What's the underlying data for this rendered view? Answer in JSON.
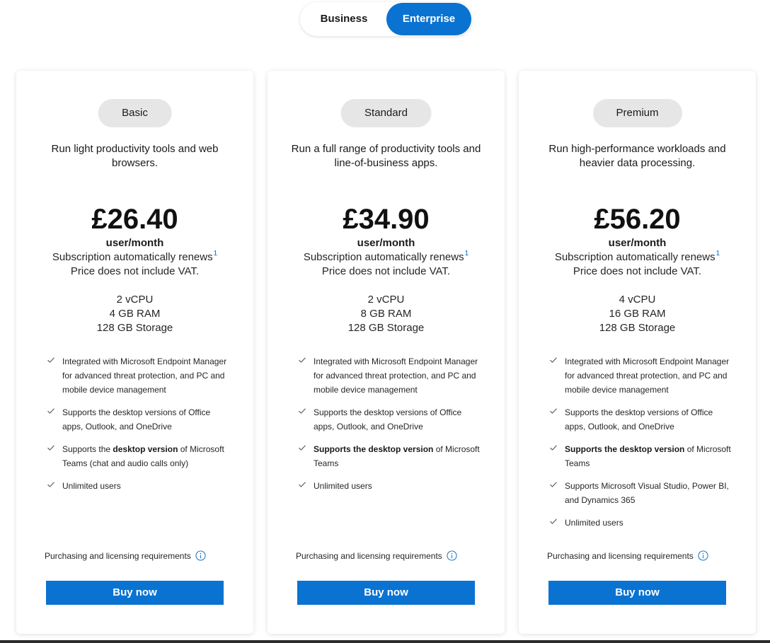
{
  "toggle": {
    "business_label": "Business",
    "enterprise_label": "Enterprise",
    "selected": "Enterprise"
  },
  "colors": {
    "accent": "#0a73d1",
    "pill_bg": "#e6e6e6",
    "footnote": "#0a6cbd"
  },
  "plans": [
    {
      "name": "Basic",
      "description": "Run light productivity tools and web browsers.",
      "price": "£26.40",
      "per": "user/month",
      "renews": "Subscription automatically renews",
      "renews_footnote": "1",
      "vat": "Price does not include VAT.",
      "specs": [
        "2 vCPU",
        "4 GB RAM",
        "128 GB Storage"
      ],
      "features": [
        {
          "pre": "Integrated with Microsoft Endpoint Manager for advanced threat protection, and PC and mobile device management",
          "bold": "",
          "post": ""
        },
        {
          "pre": "Supports the desktop versions of Office apps, Outlook, and OneDrive",
          "bold": "",
          "post": ""
        },
        {
          "pre": "Supports the ",
          "bold": "desktop version",
          "post": " of Microsoft Teams (chat and audio calls only)"
        },
        {
          "pre": "Unlimited users",
          "bold": "",
          "post": ""
        }
      ],
      "requirements": "Purchasing and licensing requirements",
      "buy_label": "Buy now"
    },
    {
      "name": "Standard",
      "description": "Run a full range of productivity tools and line-of-business apps.",
      "price": "£34.90",
      "per": "user/month",
      "renews": "Subscription automatically renews",
      "renews_footnote": "1",
      "vat": "Price does not include VAT.",
      "specs": [
        "2 vCPU",
        "8 GB RAM",
        "128 GB Storage"
      ],
      "features": [
        {
          "pre": "Integrated with Microsoft Endpoint Manager for advanced threat protection, and PC and mobile device management",
          "bold": "",
          "post": ""
        },
        {
          "pre": "Supports the desktop versions of Office apps, Outlook, and OneDrive",
          "bold": "",
          "post": ""
        },
        {
          "pre": "",
          "bold": "Supports the desktop version",
          "post": " of Microsoft Teams"
        },
        {
          "pre": "Unlimited users",
          "bold": "",
          "post": ""
        }
      ],
      "requirements": "Purchasing and licensing requirements",
      "buy_label": "Buy now"
    },
    {
      "name": "Premium",
      "description": "Run high-performance workloads and heavier data processing.",
      "price": "£56.20",
      "per": "user/month",
      "renews": "Subscription automatically renews",
      "renews_footnote": "1",
      "vat": "Price does not include VAT.",
      "specs": [
        "4 vCPU",
        "16 GB RAM",
        "128 GB Storage"
      ],
      "features": [
        {
          "pre": "Integrated with Microsoft Endpoint Manager for advanced threat protection, and PC and mobile device management",
          "bold": "",
          "post": ""
        },
        {
          "pre": "Supports the desktop versions of Office apps, Outlook, and OneDrive",
          "bold": "",
          "post": ""
        },
        {
          "pre": "",
          "bold": "Supports the desktop version",
          "post": " of Microsoft Teams"
        },
        {
          "pre": "Supports Microsoft Visual Studio, Power BI, and Dynamics 365",
          "bold": "",
          "post": ""
        },
        {
          "pre": "Unlimited users",
          "bold": "",
          "post": ""
        }
      ],
      "requirements": "Purchasing and licensing requirements",
      "buy_label": "Buy now"
    }
  ]
}
